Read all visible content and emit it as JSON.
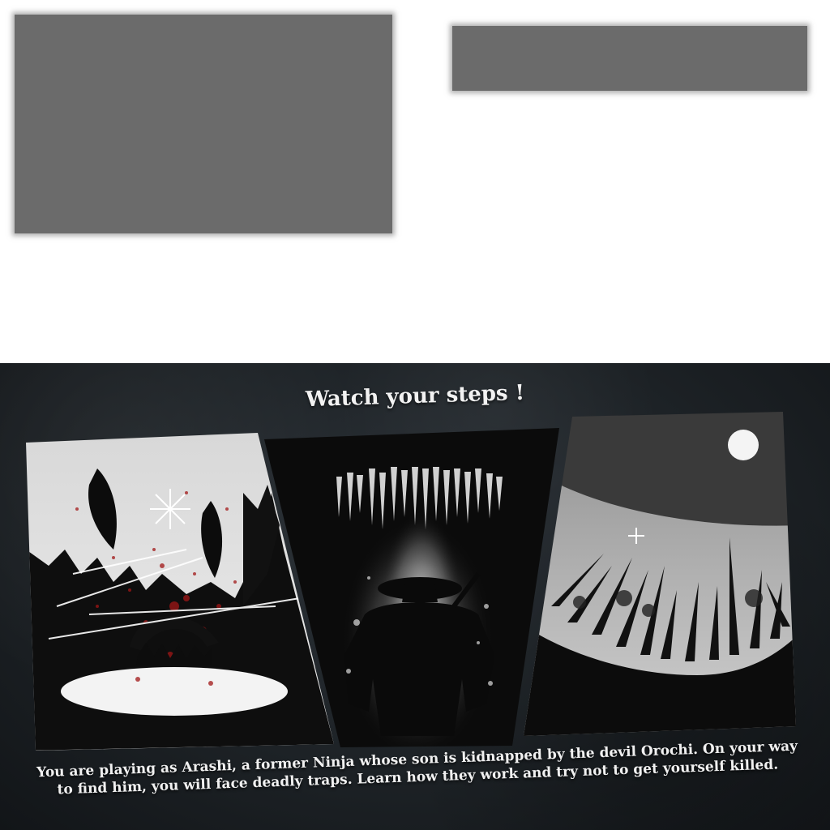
{
  "tutorial": {
    "heading": "Watch your steps !",
    "caption_line1": "You are playing as Arashi, a former Ninja whose son is kidnapped by the devil Orochi. On your way",
    "caption_line2": "to find him, you will face deadly traps. Learn how they work and try not to get yourself killed."
  },
  "colors": {
    "placeholder": "#6b6b6b",
    "background": "#1d2226",
    "blood": "#a11616"
  },
  "panels": [
    {
      "name": "bear-trap-panel",
      "icon": "bear-trap-icon"
    },
    {
      "name": "ceiling-spikes-panel",
      "icon": "ninja-silhouette-icon"
    },
    {
      "name": "spike-pit-panel",
      "icon": "spear-pit-icon"
    }
  ]
}
